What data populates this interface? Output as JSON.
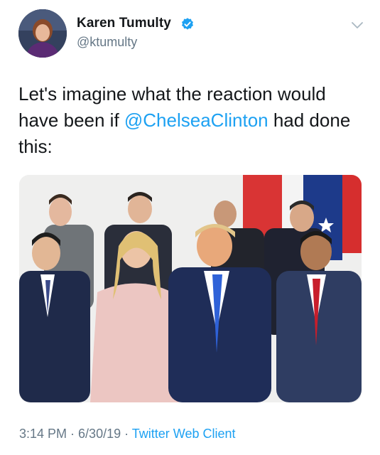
{
  "author": {
    "display_name": "Karen Tumulty",
    "handle": "@ktumulty",
    "verified": true,
    "verified_icon": "verified-badge-icon",
    "avatar": "profile-photo"
  },
  "tweet": {
    "text_before": "Let's imagine what the reaction would have been if ",
    "mention": "@ChelseaClinton",
    "text_after": " had done this:"
  },
  "media": {
    "type": "photo",
    "subject": "group of leaders seated in front of flags"
  },
  "meta": {
    "time": "3:14 PM",
    "separator1": " · ",
    "date": "6/30/19",
    "separator2": " · ",
    "source": "Twitter Web Client"
  },
  "colors": {
    "link": "#1da1f2",
    "text": "#14171a",
    "muted": "#657786",
    "verified": "#1da1f2"
  }
}
